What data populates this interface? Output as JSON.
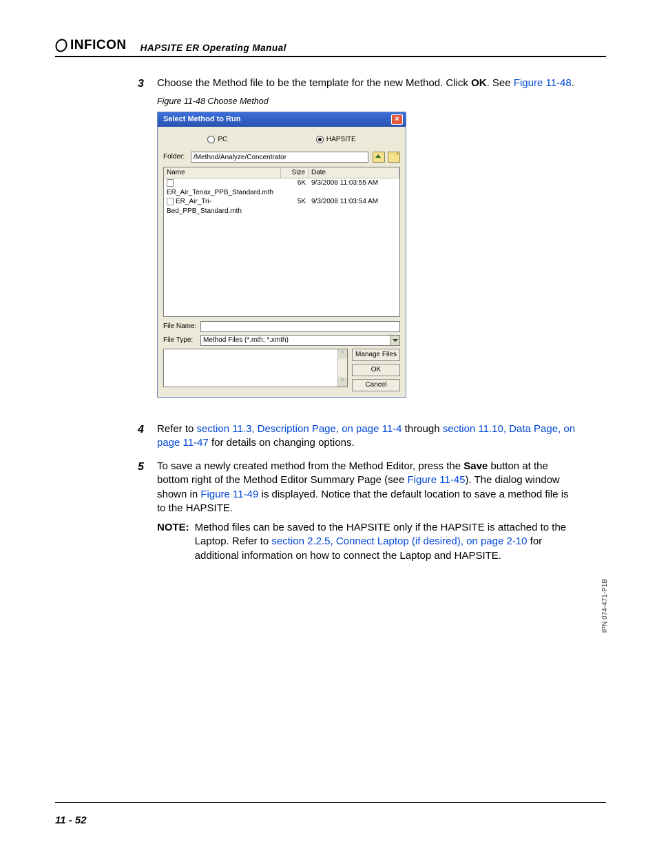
{
  "header": {
    "brand": "INFICON",
    "subtitle": "HAPSITE ER Operating Manual"
  },
  "steps": {
    "s3": {
      "num": "3",
      "t1": "Choose the Method file to be the template for the new Method. Click ",
      "bold1": "OK",
      "t2": ". See ",
      "xref": "Figure 11-48",
      "t3": "."
    },
    "caption": "Figure 11-48  Choose Method",
    "s4": {
      "num": "4",
      "t1": "Refer to ",
      "xref1": "section 11.3, Description Page, on page 11-4",
      "t2": " through ",
      "xref2": "section 11.10, Data Page, on page 11-47",
      "t3": " for details on changing options."
    },
    "s5": {
      "num": "5",
      "t1": "To save a newly created method from the Method Editor, press the ",
      "bold1": "Save",
      "t2": " button at the bottom right of the Method Editor Summary Page (see ",
      "xref1": "Figure 11-45",
      "t3": "). The dialog window shown in ",
      "xref2": "Figure 11-49",
      "t4": " is displayed. Notice that the default location to save a method file is to the HAPSITE."
    },
    "note": {
      "label": "NOTE:",
      "t1": "Method files can be saved to the HAPSITE only if the HAPSITE is attached to the Laptop. Refer to ",
      "xref": "section 2.2.5, Connect Laptop (if desired), on page 2-10",
      "t2": " for additional information on how to connect the Laptop and HAPSITE."
    }
  },
  "dialog": {
    "title": "Select Method to Run",
    "radio_pc": "PC",
    "radio_hapsite": "HAPSITE",
    "folder_label": "Folder:",
    "folder_value": "/Method/Analyze/Concentrator",
    "col_name": "Name",
    "col_size": "Size",
    "col_date": "Date",
    "rows": [
      {
        "name": "ER_Air_Tenax_PPB_Standard.mth",
        "size": "6K",
        "date": "9/3/2008 11:03:55 AM"
      },
      {
        "name": "ER_Air_Tri-Bed_PPB_Standard.mth",
        "size": "5K",
        "date": "9/3/2008 11:03:54 AM"
      }
    ],
    "file_name_label": "File Name:",
    "file_type_label": "File Type:",
    "file_type_value": "Method Files (*.mth; *.xmth)",
    "btn_manage": "Manage Files",
    "btn_ok": "OK",
    "btn_cancel": "Cancel"
  },
  "footer": {
    "page": "11 - 52",
    "ipn": "IPN 074-471-P1B"
  }
}
